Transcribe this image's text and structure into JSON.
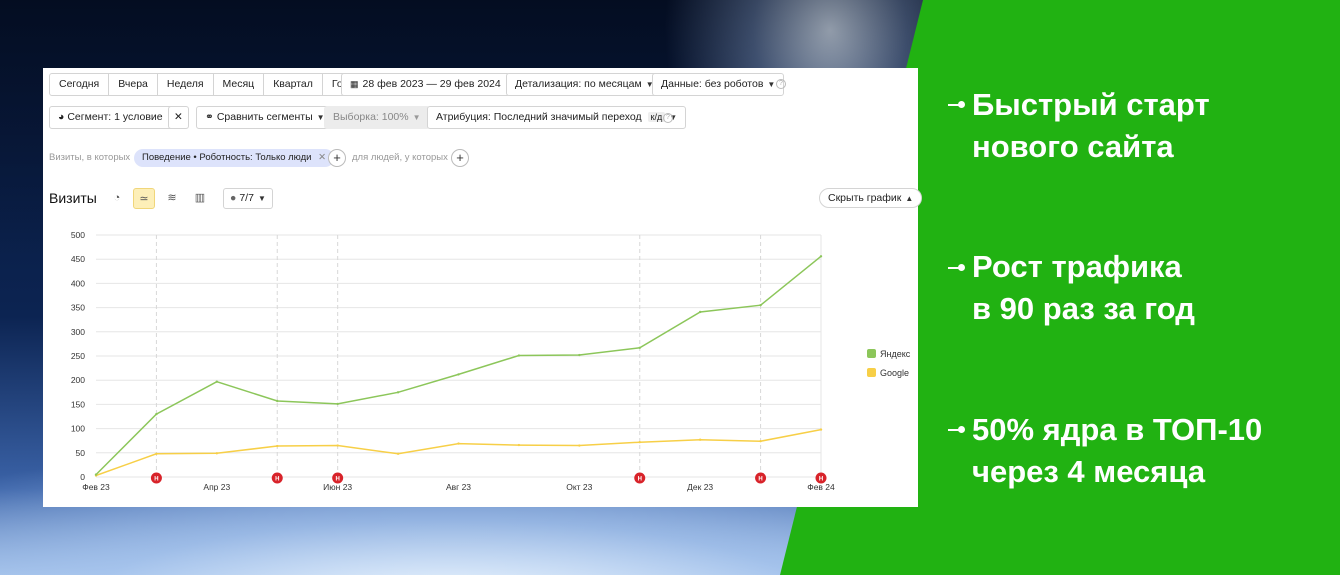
{
  "colors": {
    "green_panel": "#21b212",
    "yandex": "#8cc65a",
    "google": "#f7cf47",
    "marker": "#d8232a"
  },
  "toolbar": {
    "periods": [
      "Сегодня",
      "Вчера",
      "Неделя",
      "Месяц",
      "Квартал",
      "Год"
    ],
    "date_range": "28 фев 2023 — 29 фев 2024",
    "detail": "Детализация: по месяцам",
    "data": "Данные: без роботов"
  },
  "segments": {
    "segment": "Сегмент: 1 условие",
    "compare": "Сравнить сегменты",
    "sample": "Выборка: 100%",
    "attribution": "Атрибуция: Последний значимый переход",
    "attribution_badge": "к/д"
  },
  "filter": {
    "prefix": "Визиты, в которых",
    "chip": "Поведение • Роботность: Только люди",
    "people": "для людей, у которых"
  },
  "chart_header": {
    "title": "Визиты",
    "counter": "7/7",
    "hide": "Скрыть график"
  },
  "chart_data": {
    "type": "line",
    "title": "",
    "xlabel": "",
    "ylabel": "",
    "ylim": [
      0,
      500
    ],
    "y_ticks": [
      "0",
      "50",
      "100",
      "150",
      "200",
      "250",
      "300",
      "350",
      "400",
      "450",
      "500"
    ],
    "x_tick_labels": [
      "Фев 23",
      "Апр 23",
      "Июн 23",
      "Авг 23",
      "Окт 23",
      "Дек 23",
      "Фев 24"
    ],
    "categories": [
      "Фев 23",
      "Мар 23",
      "Апр 23",
      "Май 23",
      "Июн 23",
      "Июл 23",
      "Авг 23",
      "Сен 23",
      "Окт 23",
      "Ноя 23",
      "Дек 23",
      "Янв 24",
      "Фев 24"
    ],
    "series": [
      {
        "name": "Яндекс",
        "color": "#8cc65a",
        "values": [
          5,
          130,
          197,
          157,
          151,
          175,
          212,
          251,
          252,
          267,
          341,
          355,
          456
        ]
      },
      {
        "name": "Google",
        "color": "#f7cf47",
        "values": [
          3,
          48,
          49,
          64,
          65,
          48,
          69,
          66,
          65,
          72,
          77,
          74,
          98
        ]
      }
    ],
    "legend": "right",
    "grid": true,
    "event_markers": [
      {
        "month": "Мар 23",
        "label": "Н"
      },
      {
        "month": "Май 23",
        "label": "Н"
      },
      {
        "month": "Июн 23",
        "label": "Н"
      },
      {
        "month": "Ноя 23",
        "label": "Н"
      },
      {
        "month": "Янв 24",
        "label": "Н"
      },
      {
        "month": "Фев 24",
        "label": "Н"
      }
    ]
  },
  "bullets": [
    {
      "line1": "Быстрый старт",
      "line2": "нового сайта"
    },
    {
      "line1": "Рост трафика",
      "line2": "в 90 раз за год"
    },
    {
      "line1": "50% ядра в ТОП-10",
      "line2": "через 4 месяца"
    }
  ]
}
